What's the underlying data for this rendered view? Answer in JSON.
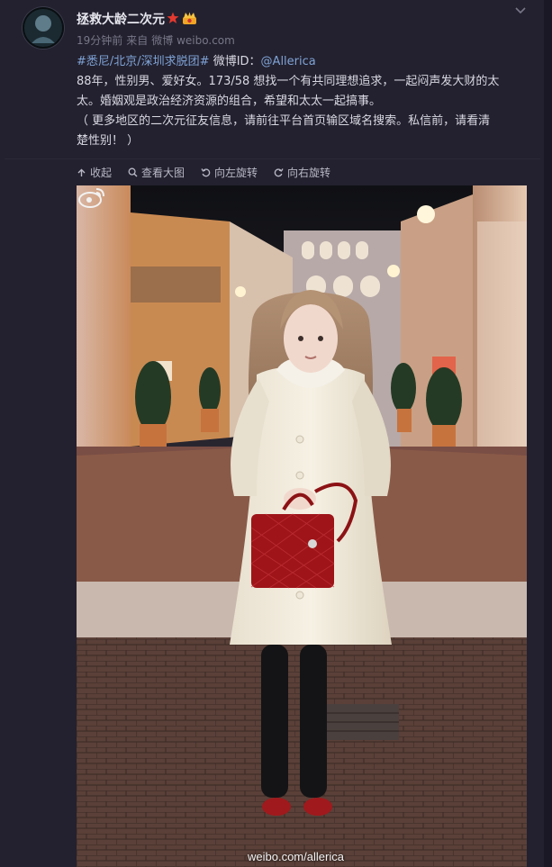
{
  "post": {
    "username": "拯救大龄二次元",
    "time": "19分钟前",
    "from_label": "来自",
    "source": "微博 weibo.com",
    "tags": "#悉尼/北京/深圳求脱团#",
    "handle_label": "微博ID：",
    "handle": "@Allerica",
    "line1": "88年，性别男、爱好女。173/58 想找一个有共同理想追求，一起闷声发大财的太",
    "line2": "太。婚姻观是政治经济资源的组合，希望和太太一起搞事。",
    "line3": "（ 更多地区的二次元征友信息，请前往平台首页输区域名搜索。私信前，请看清",
    "line4": "楚性别！ ）"
  },
  "toolbar": {
    "collect": "收起",
    "view_large": "查看大图",
    "rotate_left": "向左旋转",
    "rotate_right": "向右旋转"
  },
  "image": {
    "watermark": "weibo.com/allerica"
  },
  "icons": {
    "badge1": "red-star-icon",
    "badge2": "crown-member-icon",
    "menu": "chevron-down-icon"
  },
  "colors": {
    "background": "#23212f",
    "link": "#7fa3d6",
    "text": "#d8d8e2"
  }
}
